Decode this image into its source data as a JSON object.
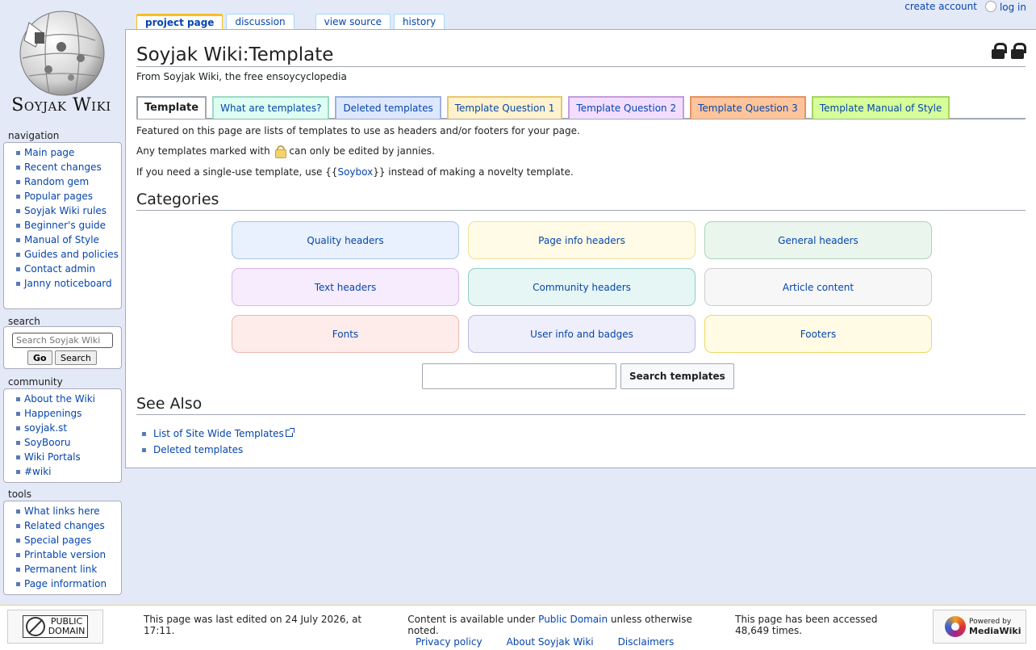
{
  "personal": {
    "create_account": "create account",
    "log_in": "log in"
  },
  "logo": {
    "wordmark": "Soyjak Wiki"
  },
  "tabs": {
    "project_page": "project page",
    "discussion": "discussion",
    "view_source": "view source",
    "history": "history"
  },
  "page": {
    "title": "Soyjak Wiki:Template",
    "tagline": "From Soyjak Wiki, the free ensoycyclopedia",
    "subtabs": [
      "Template",
      "What are templates?",
      "Deleted templates",
      "Template Question 1",
      "Template Question 2",
      "Template Question 3",
      "Template Manual of Style"
    ],
    "intro1": "Featured on this page are lists of templates to use as headers and/or footers for your page.",
    "intro2_before": "Any templates marked with",
    "intro2_after": "can only be edited by jannies.",
    "intro3_before": "If you need a single-use template, use {{",
    "intro3_link": "Soybox",
    "intro3_after": "}} instead of making a novelty template.",
    "categories_heading": "Categories",
    "categories": [
      {
        "label": "Quality headers",
        "bg": "#e8f1fd",
        "border": "#a9c4ea"
      },
      {
        "label": "Page info headers",
        "bg": "#fffbe6",
        "border": "#efe0a0"
      },
      {
        "label": "General headers",
        "bg": "#eaf5ee",
        "border": "#a9d4b7"
      },
      {
        "label": "Text headers",
        "bg": "#f6ecfd",
        "border": "#d9b7ef"
      },
      {
        "label": "Community headers",
        "bg": "#e6f6f4",
        "border": "#93ccc5"
      },
      {
        "label": "Article content",
        "bg": "#f7f7f7",
        "border": "#cccccc"
      },
      {
        "label": "Fonts",
        "bg": "#fdecea",
        "border": "#eeb8b1"
      },
      {
        "label": "User info and badges",
        "bg": "#efeffc",
        "border": "#b9b9e0"
      },
      {
        "label": "Footers",
        "bg": "#fffbe5",
        "border": "#f0d663"
      }
    ],
    "search_button": "Search templates",
    "search_value": "",
    "seealso_heading": "See Also",
    "seealso": [
      "List of Site Wide Templates",
      "Deleted templates"
    ]
  },
  "sidebar": {
    "navigation_label": "navigation",
    "navigation": [
      "Main page",
      "Recent changes",
      "Random gem",
      "Popular pages",
      "Soyjak Wiki rules",
      "Beginner's guide",
      "Manual of Style",
      "Guides and policies",
      "Contact admin",
      "Janny noticeboard"
    ],
    "search_label": "search",
    "search_placeholder": "Search Soyjak Wiki",
    "go": "Go",
    "search": "Search",
    "community_label": "community",
    "community": [
      "About the Wiki",
      "Happenings",
      "soyjak.st",
      "SoyBooru",
      "Wiki Portals",
      "#wiki"
    ],
    "tools_label": "tools",
    "tools": [
      "What links here",
      "Related changes",
      "Special pages",
      "Printable version",
      "Permanent link",
      "Page information"
    ]
  },
  "footer": {
    "pd_line1": "PUBLIC",
    "pd_line2": "DOMAIN",
    "last_edited": "This page was last edited on 24 July 2026, at 17:11.",
    "content_before": "Content is available under",
    "content_link": "Public Domain",
    "content_after": "unless otherwise noted.",
    "accessed": "This page has been accessed 48,649 times.",
    "privacy": "Privacy policy",
    "about": "About Soyjak Wiki",
    "disclaimers": "Disclaimers",
    "mw_line1": "Powered by",
    "mw_line2": "MediaWiki"
  }
}
